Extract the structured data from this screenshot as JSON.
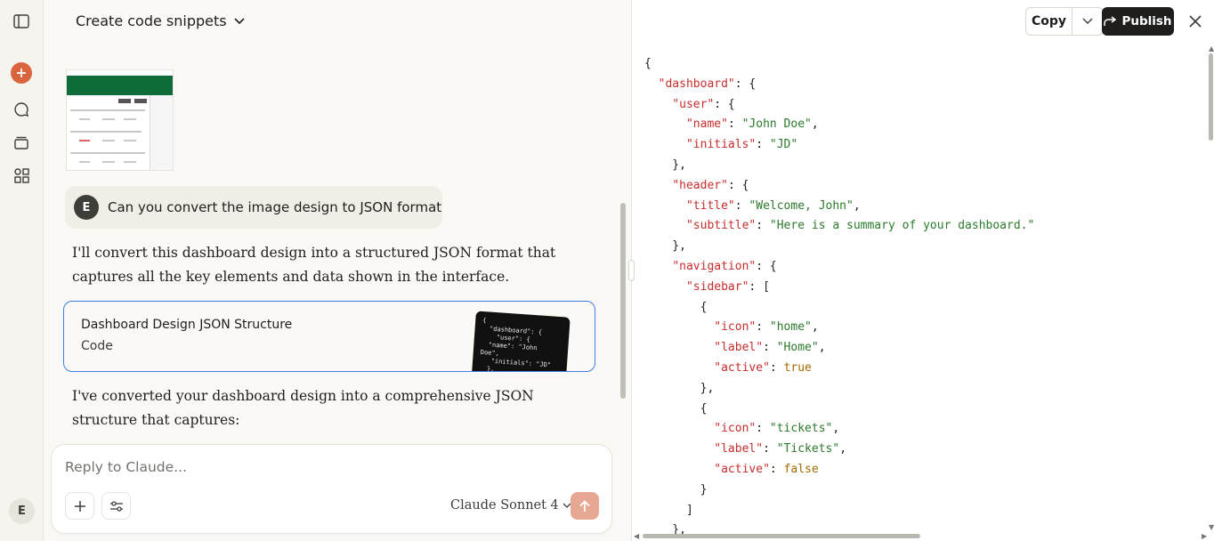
{
  "chat": {
    "title": "Create code snippets",
    "user_initial": "E",
    "user_message": "Can you convert the image design to JSON format",
    "reply_intro": "I'll convert this dashboard design into a structured JSON format that captures all the key elements and data shown in the interface.",
    "artifact": {
      "title": "Dashboard Design JSON Structure",
      "subtitle": "Code"
    },
    "reply_followup": "I've converted your dashboard design into a comprehensive JSON structure that captures:"
  },
  "composer": {
    "placeholder": "Reply to Claude...",
    "model": "Claude Sonnet 4"
  },
  "sidebar": {
    "user_initial": "E",
    "accent_color": "#d9643e"
  },
  "panel": {
    "copy_label": "Copy",
    "publish_label": "Publish"
  },
  "code_lines": [
    [
      [
        "p",
        "{"
      ]
    ],
    [
      [
        "p",
        "  "
      ],
      [
        "k",
        "\"dashboard\""
      ],
      [
        "p",
        ": {"
      ]
    ],
    [
      [
        "p",
        "    "
      ],
      [
        "k",
        "\"user\""
      ],
      [
        "p",
        ": {"
      ]
    ],
    [
      [
        "p",
        "      "
      ],
      [
        "k",
        "\"name\""
      ],
      [
        "p",
        ": "
      ],
      [
        "s",
        "\"John Doe\""
      ],
      [
        "p",
        ","
      ]
    ],
    [
      [
        "p",
        "      "
      ],
      [
        "k",
        "\"initials\""
      ],
      [
        "p",
        ": "
      ],
      [
        "s",
        "\"JD\""
      ]
    ],
    [
      [
        "p",
        "    },"
      ]
    ],
    [
      [
        "p",
        "    "
      ],
      [
        "k",
        "\"header\""
      ],
      [
        "p",
        ": {"
      ]
    ],
    [
      [
        "p",
        "      "
      ],
      [
        "k",
        "\"title\""
      ],
      [
        "p",
        ": "
      ],
      [
        "s",
        "\"Welcome, John\""
      ],
      [
        "p",
        ","
      ]
    ],
    [
      [
        "p",
        "      "
      ],
      [
        "k",
        "\"subtitle\""
      ],
      [
        "p",
        ": "
      ],
      [
        "s",
        "\"Here is a summary of your dashboard.\""
      ]
    ],
    [
      [
        "p",
        "    },"
      ]
    ],
    [
      [
        "p",
        "    "
      ],
      [
        "k",
        "\"navigation\""
      ],
      [
        "p",
        ": {"
      ]
    ],
    [
      [
        "p",
        "      "
      ],
      [
        "k",
        "\"sidebar\""
      ],
      [
        "p",
        ": ["
      ]
    ],
    [
      [
        "p",
        "        {"
      ]
    ],
    [
      [
        "p",
        "          "
      ],
      [
        "k",
        "\"icon\""
      ],
      [
        "p",
        ": "
      ],
      [
        "s",
        "\"home\""
      ],
      [
        "p",
        ","
      ]
    ],
    [
      [
        "p",
        "          "
      ],
      [
        "k",
        "\"label\""
      ],
      [
        "p",
        ": "
      ],
      [
        "s",
        "\"Home\""
      ],
      [
        "p",
        ","
      ]
    ],
    [
      [
        "p",
        "          "
      ],
      [
        "k",
        "\"active\""
      ],
      [
        "p",
        ": "
      ],
      [
        "b",
        "true"
      ]
    ],
    [
      [
        "p",
        "        },"
      ]
    ],
    [
      [
        "p",
        "        {"
      ]
    ],
    [
      [
        "p",
        "          "
      ],
      [
        "k",
        "\"icon\""
      ],
      [
        "p",
        ": "
      ],
      [
        "s",
        "\"tickets\""
      ],
      [
        "p",
        ","
      ]
    ],
    [
      [
        "p",
        "          "
      ],
      [
        "k",
        "\"label\""
      ],
      [
        "p",
        ": "
      ],
      [
        "s",
        "\"Tickets\""
      ],
      [
        "p",
        ","
      ]
    ],
    [
      [
        "p",
        "          "
      ],
      [
        "k",
        "\"active\""
      ],
      [
        "p",
        ": "
      ],
      [
        "b",
        "false"
      ]
    ],
    [
      [
        "p",
        "        }"
      ]
    ],
    [
      [
        "p",
        "      ]"
      ]
    ],
    [
      [
        "p",
        "    },"
      ]
    ]
  ],
  "preview_snippet": "{\n  \"dashboard\": {\n    \"user\": {\n  \"name\": \"John\nDoe\",\n   \"initials\": \"JD\"\n  },\n  \"header\": {\n   \"title\":\n \"Welcome, John\""
}
